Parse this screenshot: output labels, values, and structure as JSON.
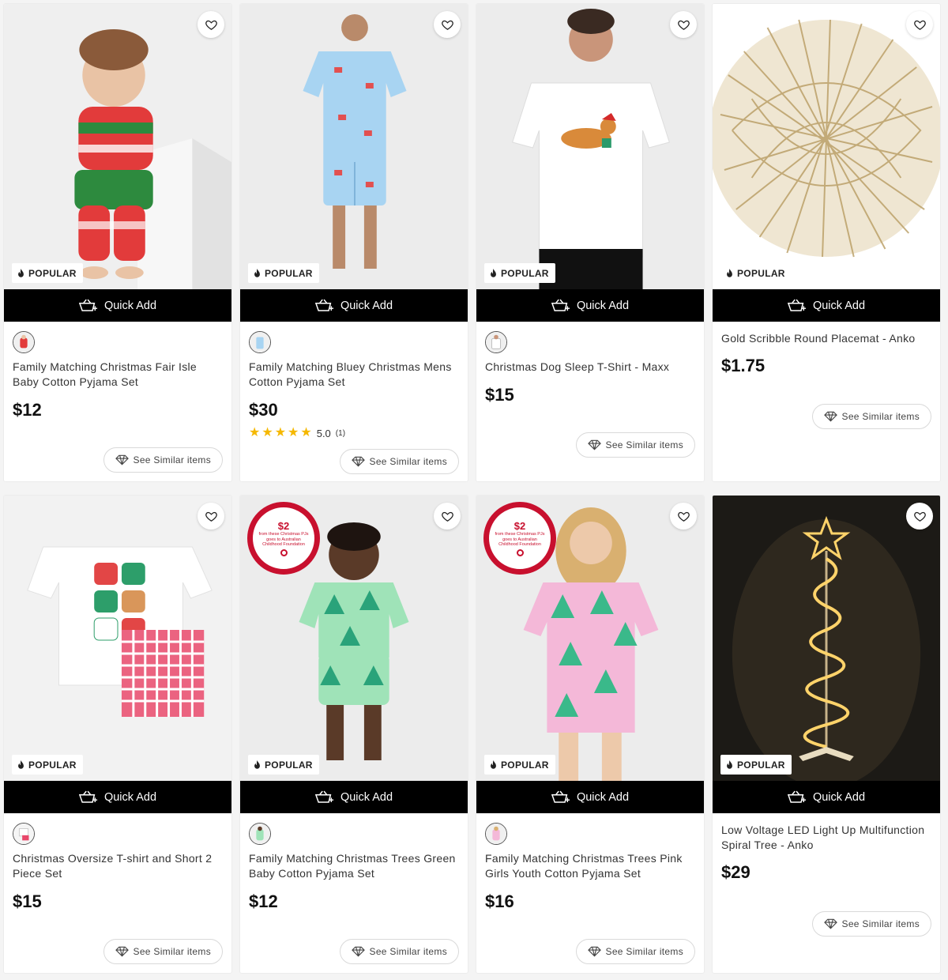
{
  "common": {
    "popular_label": "POPULAR",
    "quick_add_label": "Quick Add",
    "see_similar_label": "See Similar items"
  },
  "products": [
    {
      "title": "Family Matching Christmas Fair Isle Baby Cotton Pyjama Set",
      "price": "$12",
      "image": "baby-fair-isle-pyjama",
      "has_swatch": true
    },
    {
      "title": "Family Matching Bluey Christmas Mens Cotton Pyjama Set",
      "price": "$30",
      "image": "mens-bluey-pyjama",
      "has_swatch": true,
      "rating": {
        "score": "5.0",
        "count": "(1)",
        "stars": 5
      }
    },
    {
      "title": "Christmas Dog Sleep T-Shirt - Maxx",
      "price": "$15",
      "image": "dog-sleep-tshirt",
      "has_swatch": true
    },
    {
      "title": "Gold Scribble Round Placemat - Anko",
      "price": "$1.75",
      "image": "gold-scribble-placemat",
      "has_swatch": false
    },
    {
      "title": "Christmas Oversize T-shirt and Short 2 Piece Set",
      "price": "$15",
      "image": "oversize-tshirt-short-set",
      "has_swatch": true
    },
    {
      "title": "Family Matching Christmas Trees Green Baby Cotton Pyjama Set",
      "price": "$12",
      "image": "green-trees-baby-pyjama",
      "has_swatch": true,
      "promo": {
        "amount": "$2",
        "text": "from these Christmas PJs goes to Australian Childhood Foundation"
      }
    },
    {
      "title": "Family Matching Christmas Trees Pink Girls Youth Cotton Pyjama Set",
      "price": "$16",
      "image": "pink-trees-girls-pyjama",
      "has_swatch": true,
      "promo": {
        "amount": "$2",
        "text": "from these Christmas PJs goes to Australian Childhood Foundation"
      }
    },
    {
      "title": "Low Voltage LED Light Up Multifunction Spiral Tree - Anko",
      "price": "$29",
      "image": "led-spiral-tree",
      "has_swatch": false
    }
  ],
  "colors": {
    "quick_add_bg": "#000000",
    "star": "#f5b800",
    "promo_red": "#c8102e"
  }
}
